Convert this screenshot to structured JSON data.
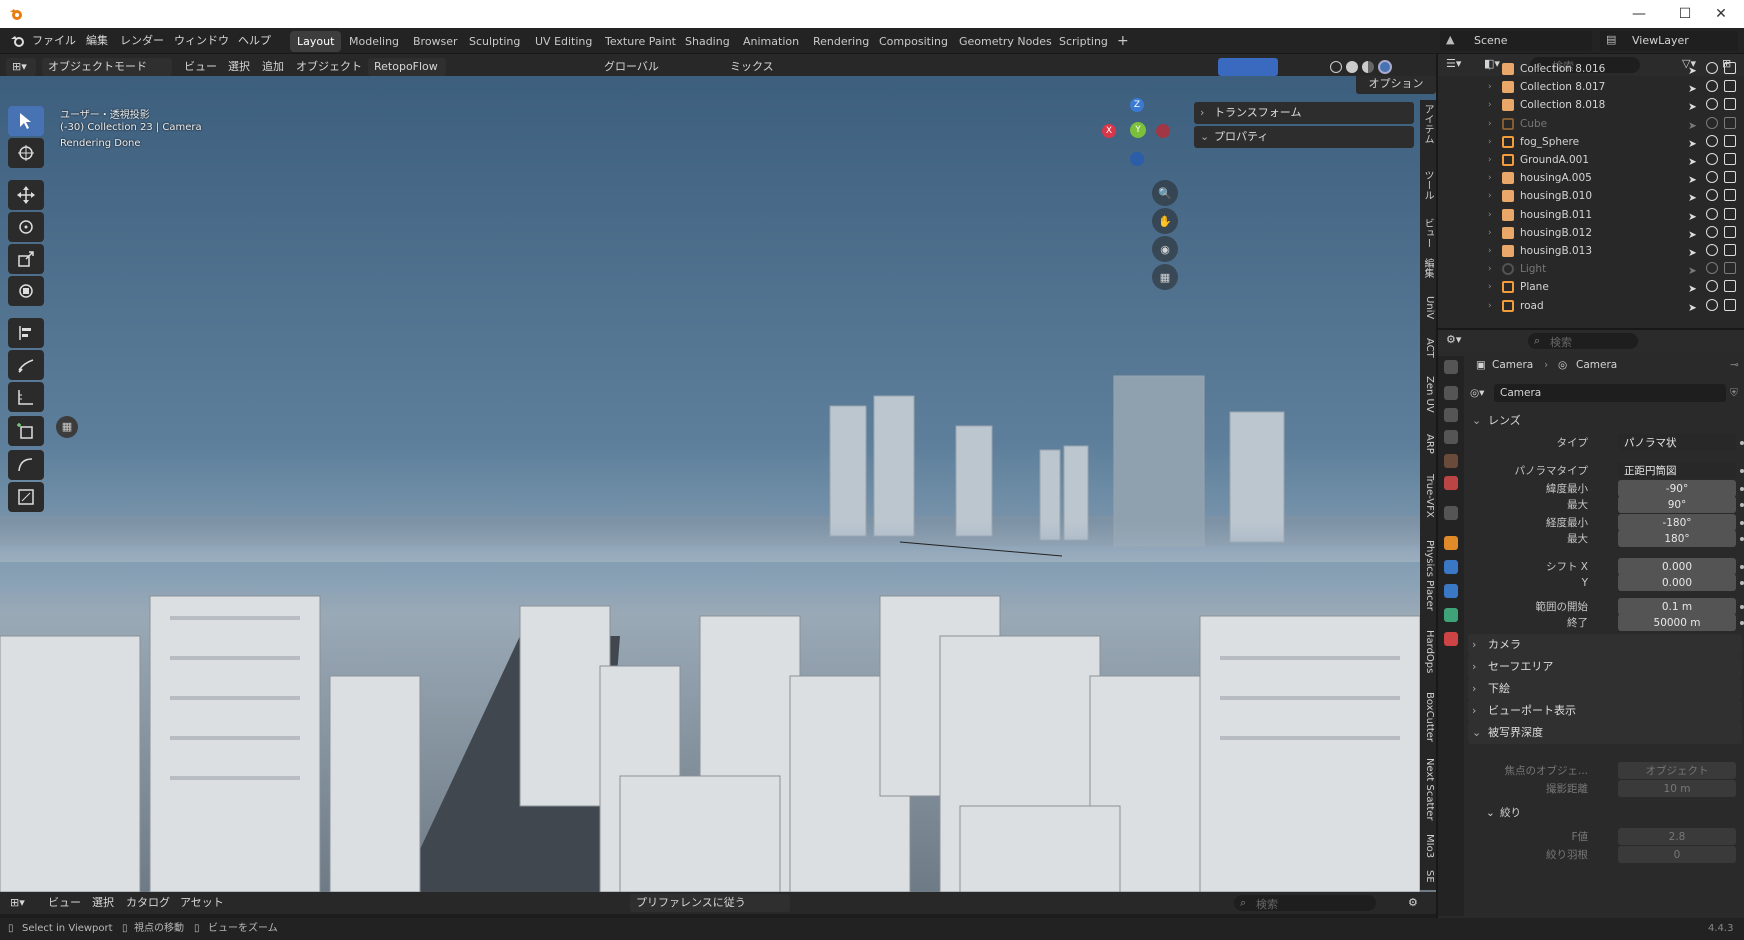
{
  "title_bar": {
    "logo": "blender-logo-icon",
    "controls": [
      "minimize",
      "maximize",
      "close"
    ]
  },
  "menu": [
    "ファイル",
    "編集",
    "レンダー",
    "ウィンドウ",
    "ヘルプ"
  ],
  "workspaces": [
    "Layout",
    "Modeling",
    "Browser",
    "Sculpting",
    "UV Editing",
    "Texture Paint",
    "Shading",
    "Animation",
    "Rendering",
    "Compositing",
    "Geometry Nodes",
    "Scripting"
  ],
  "active_workspace": "Layout",
  "scene": {
    "label": "Scene",
    "view_layer": "ViewLayer"
  },
  "viewport_header": {
    "mode": "オブジェクトモード",
    "menus": [
      "ビュー",
      "選択",
      "追加",
      "オブジェクト"
    ],
    "addon": "RetopoFlow",
    "transform": "グローバル",
    "snap": "ミックス",
    "options": "オプション"
  },
  "viewport_overlay": {
    "line1": "ユーザー・透視投影",
    "line2": "(-30) Collection 23 | Camera",
    "line3": "Rendering Done"
  },
  "n_panel": {
    "transform": "トランスフォーム",
    "properties": "プロパティ"
  },
  "side_tabs": [
    "アイテム",
    "ツール",
    "ビュー",
    "編集",
    "UniV",
    "ACT",
    "Zen UV",
    "ARP",
    "True-VFX",
    "Physics Placer",
    "HardOps",
    "BoxCutter",
    "Next Scatter",
    "MIo3",
    "SE"
  ],
  "outliner": {
    "search_placeholder": "検索",
    "rows": [
      {
        "name": "Collection 8.016",
        "type": "collection",
        "partial": true
      },
      {
        "name": "Collection 8.017",
        "type": "collection"
      },
      {
        "name": "Collection 8.018",
        "type": "collection"
      },
      {
        "name": "Cube",
        "type": "mesh",
        "hidden": true
      },
      {
        "name": "fog_Sphere",
        "type": "mesh"
      },
      {
        "name": "GroundA.001",
        "type": "mesh"
      },
      {
        "name": "housingA.005",
        "type": "collection"
      },
      {
        "name": "housingB.010",
        "type": "collection"
      },
      {
        "name": "housingB.011",
        "type": "collection"
      },
      {
        "name": "housingB.012",
        "type": "collection"
      },
      {
        "name": "housingB.013",
        "type": "collection"
      },
      {
        "name": "Light",
        "type": "light",
        "hidden": true
      },
      {
        "name": "Plane",
        "type": "mesh"
      },
      {
        "name": "road",
        "type": "mesh"
      }
    ]
  },
  "properties": {
    "search_placeholder": "検索",
    "breadcrumb": [
      "Camera",
      "Camera"
    ],
    "datablock": "Camera",
    "lens_section": "レンズ",
    "fields": [
      {
        "label": "タイプ",
        "value": "パノラマ状",
        "kind": "menu"
      },
      {
        "label": "パノラマタイプ",
        "value": "正距円筒図",
        "kind": "menu"
      },
      {
        "label": "緯度最小",
        "value": "-90°"
      },
      {
        "label": "最大",
        "value": "90°"
      },
      {
        "label": "経度最小",
        "value": "-180°"
      },
      {
        "label": "最大",
        "value": "180°"
      },
      {
        "label": "シフト X",
        "value": "0.000"
      },
      {
        "label": "Y",
        "value": "0.000"
      },
      {
        "label": "範囲の開始",
        "value": "0.1 m"
      },
      {
        "label": "終了",
        "value": "50000 m"
      }
    ],
    "sections": [
      "カメラ",
      "セーフエリア",
      "下絵",
      "ビューポート表示",
      "被写界深度"
    ],
    "dof": {
      "focus_label": "焦点のオブジェ...",
      "focus_value": "オブジェクト",
      "distance_label": "撮影距離",
      "distance_value": "10 m",
      "aperture": "絞り",
      "fstop_label": "F値",
      "fstop_value": "2.8",
      "blades_label": "絞り羽根",
      "blades_value": "0"
    }
  },
  "bottom_bar": {
    "menus": [
      "ビュー",
      "選択",
      "カタログ",
      "アセット"
    ],
    "preference": "プリファレンスに従う",
    "search_placeholder": "検索"
  },
  "status_bar": {
    "items": [
      "Select in Viewport",
      "視点の移動",
      "ビューをズーム"
    ],
    "version": "4.4.3"
  },
  "colors": {
    "accent": "#4772b3",
    "collection": "#e9a86a",
    "mesh": "#f29c3b",
    "vertex": "#60c27a"
  }
}
